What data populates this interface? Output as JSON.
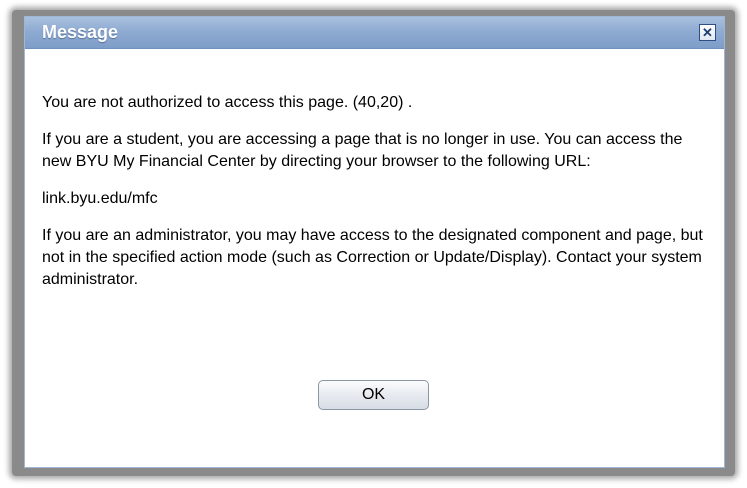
{
  "dialog": {
    "title": "Message",
    "close_icon": "close-icon",
    "messages": [
      "You are not authorized to access this page. (40,20) .",
      "If you are a student, you are accessing a page that is no longer in use.  You can access the new BYU My Financial Center by directing your browser to the following URL:",
      "link.byu.edu/mfc",
      "If you are an administrator, you may have access to the designated component and page, but not in the specified action mode (such as Correction or Update/Display).  Contact your system administrator."
    ],
    "ok_label": "OK"
  },
  "colors": {
    "titlebar": "#8fabd2",
    "title_text": "#ffffff"
  }
}
